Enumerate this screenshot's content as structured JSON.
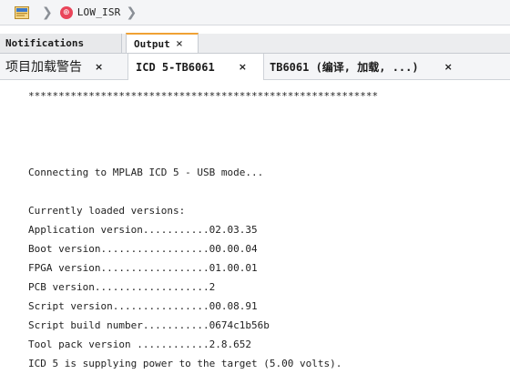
{
  "breadcrumb": {
    "file_icon": "source-file-icon",
    "separator_icon": "chevron-right-icon",
    "isr_icon": "isr-function-icon",
    "function_label": "LOW_ISR"
  },
  "panel_tabs": [
    {
      "label": "Notifications",
      "active": false
    },
    {
      "label": "Output",
      "active": true,
      "close": "×"
    }
  ],
  "output_tabs": [
    {
      "label": "项目加载警告",
      "close": "×",
      "active": false
    },
    {
      "label": "ICD 5-TB6061",
      "close": "×",
      "active": true
    },
    {
      "label": "TB6061 (编译, 加载, ...)",
      "close": "×",
      "active": false
    }
  ],
  "output": {
    "lines": [
      "**********************************************************",
      "",
      "",
      "",
      "",
      "Connecting to MPLAB ICD 5 - USB mode...",
      "",
      "Currently loaded versions:",
      "Application version...........02.03.35",
      "Boot version..................00.00.04",
      "FPGA version..................01.00.01",
      "PCB version...................2",
      "Script version................00.08.91",
      "Script build number...........0674c1b56b",
      "Tool pack version ............2.8.652",
      "ICD 5 is supplying power to the target (5.00 volts)."
    ]
  },
  "colors": {
    "active_tab_accent": "#f0a133",
    "isr_icon_bg": "#e9455a"
  }
}
